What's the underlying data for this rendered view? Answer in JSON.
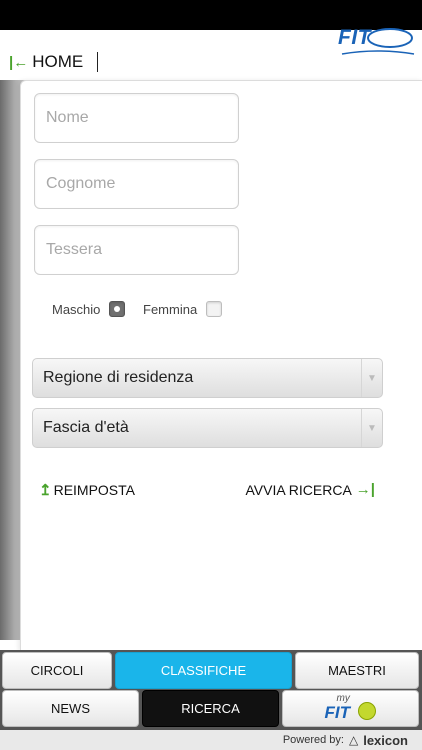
{
  "header": {
    "logo_text": "FIT",
    "home_label": "HOME"
  },
  "form": {
    "nome_placeholder": "Nome",
    "cognome_placeholder": "Cognome",
    "tessera_placeholder": "Tessera",
    "gender": {
      "maschio_label": "Maschio",
      "femmina_label": "Femmina",
      "selected": "Maschio"
    },
    "regione_select": "Regione di residenza",
    "fascia_select": "Fascia d'età",
    "reset_label": "REIMPOSTA",
    "search_label": "AVVIA RICERCA"
  },
  "tabs": {
    "row1": [
      "CIRCOLI",
      "CLASSIFICHE",
      "MAESTRI"
    ],
    "row2": [
      "NEWS",
      "RICERCA"
    ],
    "myfit_my": "my",
    "myfit_fit": "FIT",
    "active_blue": "CLASSIFICHE",
    "active_dark": "RICERCA"
  },
  "footer": {
    "powered_by": "Powered by:",
    "brand": "lexicon"
  },
  "colors": {
    "accent_blue": "#1ab5ea",
    "brand_blue": "#1a63b7",
    "green_arrow": "#4aa32d"
  },
  "icons": {
    "home_arrow": "arrow-left-bar-icon",
    "reset": "arrow-up-icon",
    "search": "arrow-right-bar-icon",
    "select_chevron": "chevron-down-icon"
  }
}
